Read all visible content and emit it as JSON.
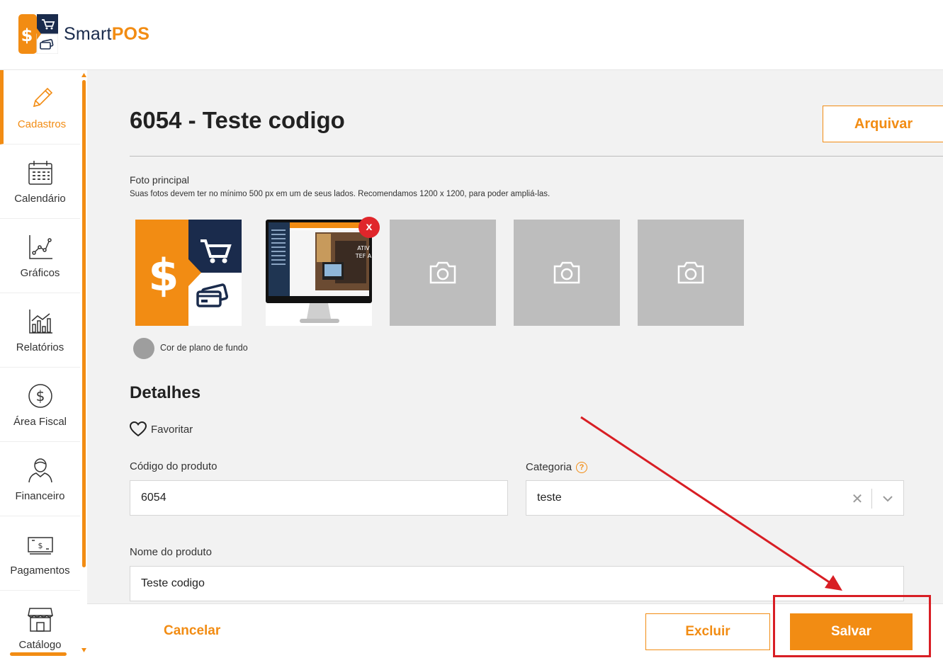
{
  "brand": {
    "name_prefix": "Smart",
    "name_suffix": "POS",
    "accent_color": "#f28c13",
    "navy_color": "#1a2b4c"
  },
  "sidebar": {
    "items": [
      {
        "label": "Cadastros",
        "icon": "pencil-icon",
        "active": true
      },
      {
        "label": "Calendário",
        "icon": "calendar-icon"
      },
      {
        "label": "Gráficos",
        "icon": "line-chart-icon"
      },
      {
        "label": "Relatórios",
        "icon": "bar-chart-icon"
      },
      {
        "label": "Área Fiscal",
        "icon": "dollar-circle-icon"
      },
      {
        "label": "Financeiro",
        "icon": "person-icon"
      },
      {
        "label": "Pagamentos",
        "icon": "banknote-icon"
      },
      {
        "label": "Catálogo",
        "icon": "storefront-icon"
      }
    ]
  },
  "header": {
    "title": "6054 - Teste codigo",
    "archive_label": "Arquivar"
  },
  "photos": {
    "label": "Foto principal",
    "hint": "Suas fotos devem ter no mínimo 500 px em um de seus lados. Recomendamos 1200 x 1200, para poder ampliá-las.",
    "remove_label": "x",
    "bg_color_label": "Cor de plano de fundo",
    "bg_color": "#9e9e9e"
  },
  "details": {
    "section_title": "Detalhes",
    "favorite_label": "Favoritar",
    "code_label": "Código do produto",
    "code_value": "6054",
    "category_label": "Categoria",
    "category_help": "?",
    "category_value": "teste",
    "category_clear": "✕",
    "name_label": "Nome do produto",
    "name_value": "Teste codigo"
  },
  "footer": {
    "cancel_label": "Cancelar",
    "delete_label": "Excluir",
    "save_label": "Salvar"
  },
  "annotation": {
    "color": "#d81e24"
  }
}
